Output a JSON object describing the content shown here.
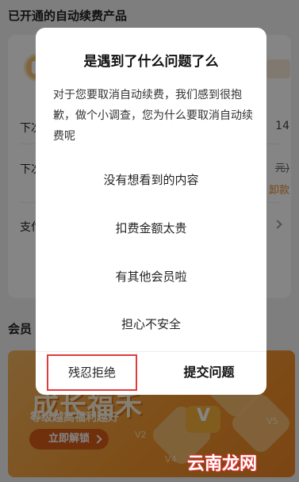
{
  "background": {
    "section_title": "已开通的自动续费产品",
    "rows": [
      {
        "label": "下次",
        "value": "14"
      },
      {
        "label": "下次",
        "value": "元)",
        "value2": "卸款"
      },
      {
        "label": "支付",
        "value": ""
      }
    ],
    "second_section_title": "会员",
    "banner": {
      "headline": "成长福禾",
      "subtitle": "等级越高福利越好",
      "cta": "立即解锁",
      "levels": [
        "V2",
        "V4",
        "V5"
      ],
      "crown_label": "V"
    }
  },
  "dialog": {
    "title": "是遇到了什么问题了么",
    "description": "对于您要取消自动续费，我们感到很抱歉，做个小调查，您为什么要取消自动续费呢",
    "options": [
      "没有想看到的内容",
      "扣费金额太贵",
      "有其他会员啦",
      "担心不安全"
    ],
    "refuse_label": "残忍拒绝",
    "submit_label": "提交问题"
  },
  "watermark": "云南龙网",
  "colors": {
    "highlight_border": "#e23b3b",
    "banner_orange": "#f1962e",
    "overlay": "rgba(0,0,0,0.48)"
  }
}
